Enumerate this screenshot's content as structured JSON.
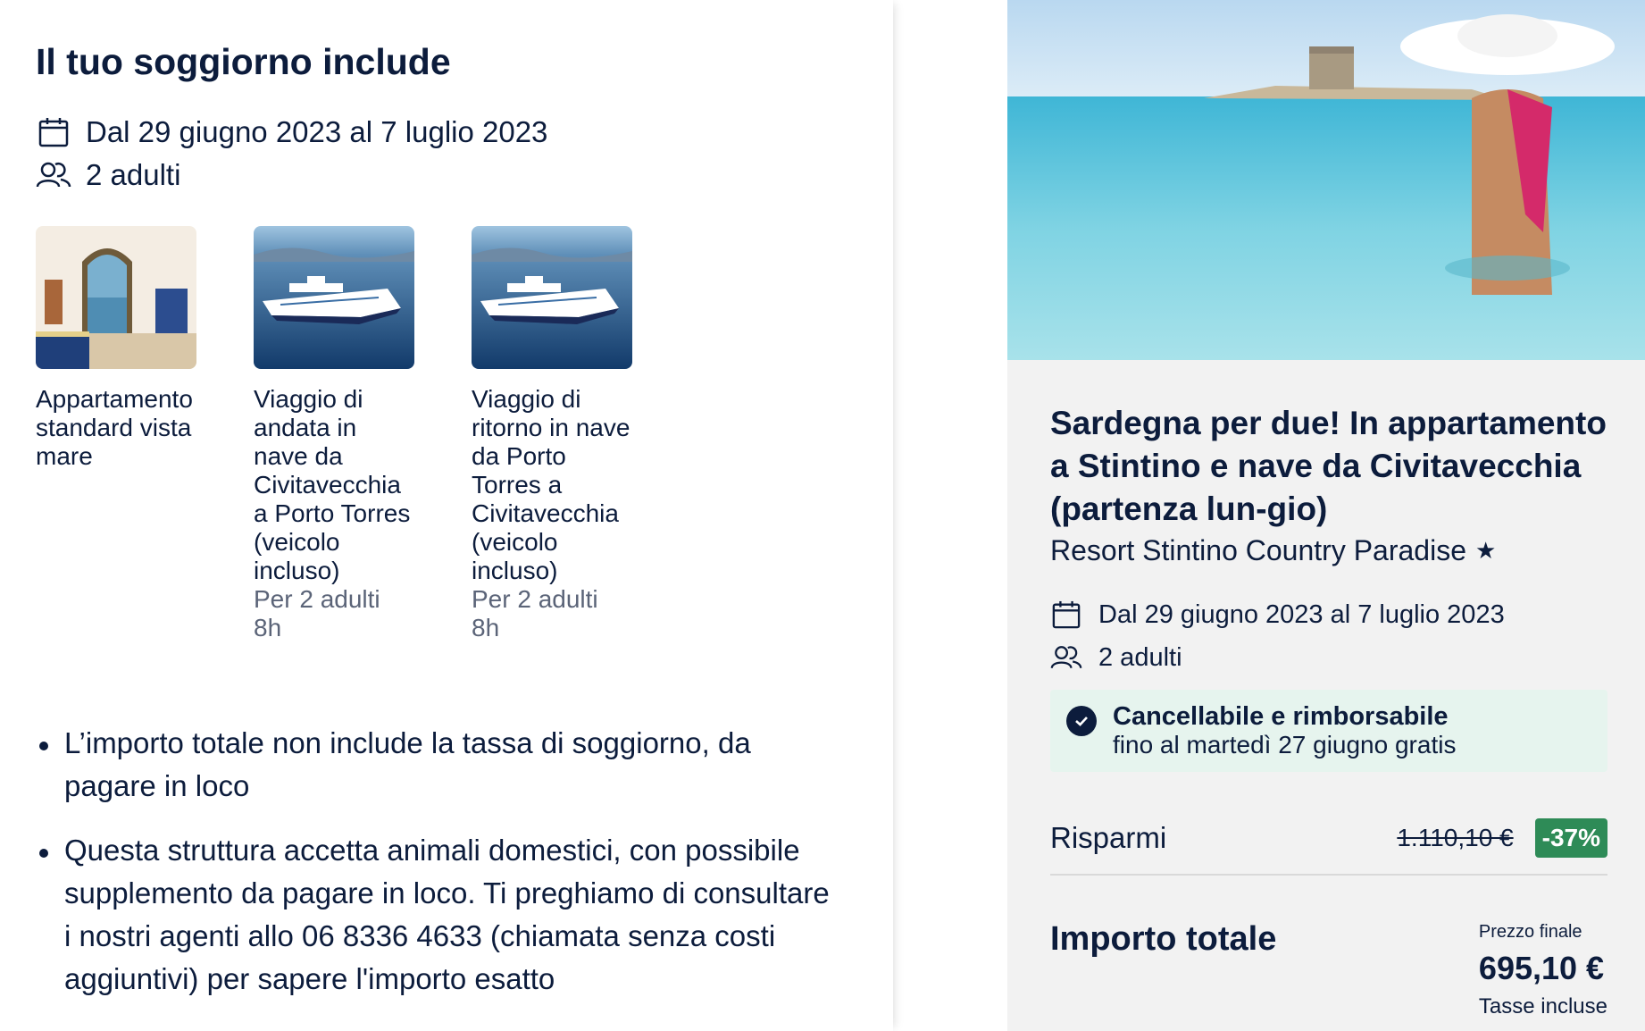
{
  "summary": {
    "heading": "Il tuo soggiorno include",
    "dates": "Dal 29 giugno 2023 al 7 luglio 2023",
    "guests": "2 adulti"
  },
  "items": [
    {
      "title": "Appartamento standard vista mare",
      "per": "",
      "duration": "",
      "image": "apartment-room"
    },
    {
      "title": "Viaggio di andata in nave da Civitavecchia a Porto Torres (veicolo incluso)",
      "per": "Per 2 adulti",
      "duration": "8h",
      "image": "ferry-ship"
    },
    {
      "title": "Viaggio di ritorno in nave da Porto Torres a Civitavecchia (veicolo incluso)",
      "per": "Per 2 adulti",
      "duration": "8h",
      "image": "ferry-ship"
    }
  ],
  "notes": [
    "L’importo totale non include la tassa di soggiorno, da pagare in loco",
    "Questa struttura accetta animali domestici, con possibile supplemento da pagare in loco. Ti preghiamo di consultare i nostri agenti allo 06 8336 4633 (chiamata senza costi aggiuntivi) per sapere l'importo esatto"
  ],
  "offer": {
    "title": "Sardegna per due! In appartamento a Stintino e nave da Civitavecchia (partenza lun-gio)",
    "hotel": "Resort Stintino Country Paradise",
    "star": "★",
    "dates": "Dal 29 giugno 2023 al 7 luglio 2023",
    "guests": "2 adulti",
    "cancel_title": "Cancellabile e rimborsabile",
    "cancel_sub": "fino al martedì 27 giugno gratis",
    "save_label": "Risparmi",
    "old_price": "1.110,10 €",
    "discount": "-37%",
    "total_label": "Importo totale",
    "price_caption": "Prezzo finale",
    "price": "695,10 €",
    "tax_note": "Tasse incluse"
  },
  "colors": {
    "text": "#0c1c3c",
    "muted": "#5b6478",
    "discount_bg": "#2e8b57",
    "cancel_bg": "#e6f4ee",
    "panel_bg": "#f2f2f2"
  }
}
